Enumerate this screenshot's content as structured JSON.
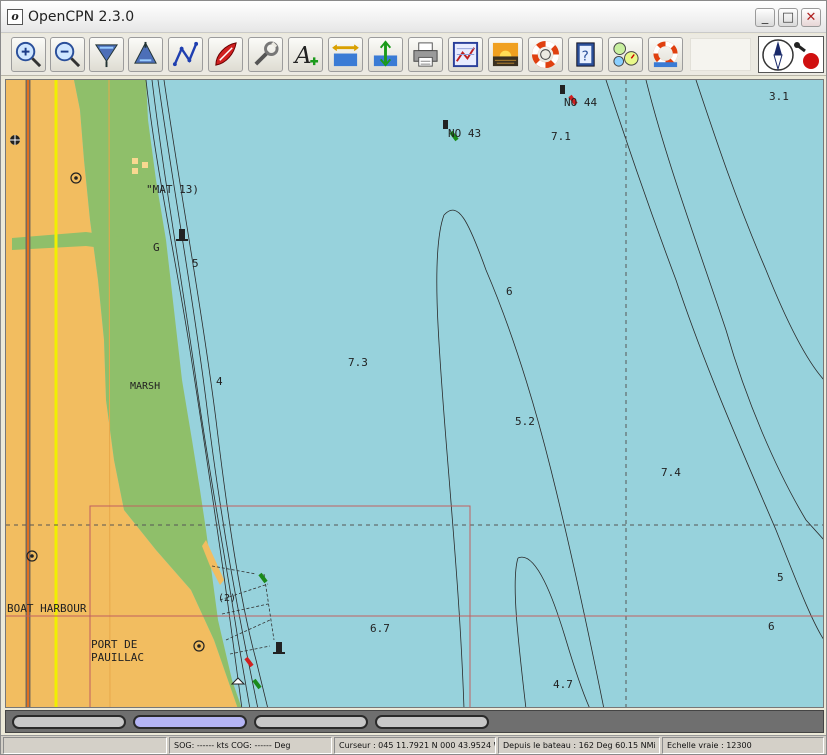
{
  "window": {
    "title": "OpenCPN 2.3.0",
    "app_icon_glyph": "o"
  },
  "title_buttons": {
    "minimize": "_",
    "maximize": "□",
    "close": "✕"
  },
  "toolbar": {
    "items": [
      {
        "name": "zoom-in",
        "icon": "zoom-in-icon"
      },
      {
        "name": "zoom-out",
        "icon": "zoom-out-icon"
      },
      {
        "name": "scale-in",
        "icon": "scale-in-icon"
      },
      {
        "name": "scale-out",
        "icon": "scale-out-icon"
      },
      {
        "name": "create-route",
        "icon": "route-icon"
      },
      {
        "name": "auto-follow",
        "icon": "ship-icon"
      },
      {
        "name": "settings",
        "icon": "wrench-icon"
      },
      {
        "name": "text",
        "icon": "text-icon"
      },
      {
        "name": "current",
        "icon": "current-icon"
      },
      {
        "name": "tide",
        "icon": "tide-icon"
      },
      {
        "name": "print",
        "icon": "printer-icon"
      },
      {
        "name": "route-manager",
        "icon": "route-manager-icon"
      },
      {
        "name": "color-scheme",
        "icon": "sunset-icon"
      },
      {
        "name": "mob",
        "icon": "lifebuoy-icon"
      },
      {
        "name": "help",
        "icon": "help-book-icon"
      },
      {
        "name": "gauges",
        "icon": "gauges-icon"
      },
      {
        "name": "man-overboard",
        "icon": "mob-icon"
      }
    ]
  },
  "chart": {
    "labels": {
      "no44": "NO 44",
      "no43": "NO 43",
      "mat13": "\"MAT 13)",
      "g": "G",
      "marsh": "MARSH",
      "boat_harbour": "BOAT HARBOUR",
      "port_de": "PORT DE",
      "pauillac": "PAUILLAC",
      "p2": "(2)"
    },
    "soundings": {
      "s31": "3.1",
      "s71": "7.1",
      "s5a": "5",
      "s6a": "6",
      "s73": "7.3",
      "s4": "4",
      "s52": "5.2",
      "s74": "7.4",
      "s5b": "5",
      "s6b": "6",
      "s67": "6.7",
      "s47": "4.7"
    },
    "colors": {
      "water": "#97d2dc",
      "land": "#f2bd60",
      "marsh": "#8fbf6a",
      "quilt_border": "#c06060"
    }
  },
  "chart_bar": {
    "pill_count": 4,
    "active_index": 1
  },
  "status": {
    "sog_cog": "SOG: ------ kts  COG: ------ Deg",
    "cursor": "Curseur : 045 11.7921 N 000 43.9524 W",
    "from_ship": "Depuis le bateau : 162 Deg   60.15 NMi",
    "scale": "Echelle vraie :     12300"
  }
}
